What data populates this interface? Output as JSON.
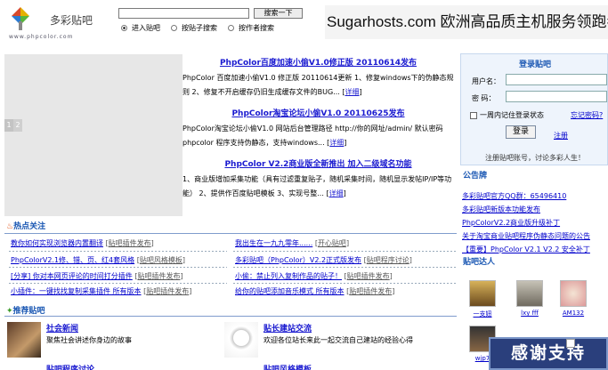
{
  "logo": {
    "name": "多彩贴吧",
    "url": "www.phpcolor.com"
  },
  "search": {
    "button": "搜索一下",
    "radios": [
      "进入贴吧",
      "按贴子搜索",
      "按作者搜索"
    ],
    "selected": 0
  },
  "banner": {
    "text": "Sugarhosts.com 欧洲高品质主机服务领跑者"
  },
  "slider": {
    "prev": "1",
    "next": "2"
  },
  "news": [
    {
      "title": "PhpColor百度加速小偷V1.0修正版 20110614发布",
      "desc": "PhpColor 百度加速小偷V1.0 修正版 20110614更新 1、修复windows下的伪静态规则 2、修复不开启缓存仍旧生成缓存文件的BUG...",
      "more": "详细"
    },
    {
      "title": "PhpColor淘宝论坛小偷V1.0 20110625发布",
      "desc": "PhpColor淘宝论坛小偷V1.0 网站后台管理路径 http://你的网址/admin/ 默认密码 phpcolor 程序支持伪静态，支持windows...",
      "more": "详细"
    },
    {
      "title": "PhpColor V2.2商业版全新推出 加入二级域名功能",
      "desc": "1、商业版增加采集功能（具有过滤重复贴子，随机采集时间，随机显示发帖IP/IP等功能） 2、提供作百度贴吧模板 3、实现号整...",
      "more": "详细"
    }
  ],
  "login": {
    "title": "登录贴吧",
    "user_label": "用户名：",
    "pass_label": "密  码：",
    "remember": "一周内记住登录状态",
    "forgot": "忘记密码?",
    "login_btn": "登录",
    "register": "注册",
    "hint": "注册贴吧账号，讨论多彩人生！"
  },
  "notice": {
    "title": "公告牌",
    "items": [
      "多彩贴吧官方QQ群：65496410",
      "多彩贴吧新版本功能发布",
      "PhpColorV2.2商业版升级补丁",
      "关于淘宝商业贴吧程序伪静态问题的公告",
      "【重要】PhpColor V2.1 V2.2 安全补丁"
    ]
  },
  "users": {
    "title": "贴吧达人",
    "items": [
      "一支妞",
      "lxy fff",
      "AM132",
      "wjp7"
    ]
  },
  "hot": {
    "title": "热点关注",
    "items": [
      {
        "title": "教你如何实现浏览器内置翻译",
        "tag": "贴吧插件发布"
      },
      {
        "title": "我出生在一九九零年......",
        "tag": "开心贴吧"
      },
      {
        "title": "PhpColorV2.1修、错、页、红4套风格",
        "tag": "贴吧风格模板"
      },
      {
        "title": "多彩贴吧（PhpColor）V2.2正式版发布",
        "tag": "贴吧程序讨论"
      },
      {
        "title": "[分享] 你对本网页评论的时间打分插件",
        "tag": "贴吧插件发布"
      },
      {
        "title": "小偷：禁止列入复制作品的贴子！",
        "tag": "贴吧插件发布"
      },
      {
        "title": "小插件：一键找找复制采集插件 所有版本",
        "tag": "贴吧插件发布"
      },
      {
        "title": "给你的贴吧添加音乐模式 所有版本",
        "tag": "贴吧插件发布"
      }
    ]
  },
  "recommend": {
    "title": "推荐贴吧",
    "items": [
      {
        "title": "社会新闻",
        "desc": "聚焦社会讲述你身边的故事"
      },
      {
        "title": "贴长建站交流",
        "desc": "欢迎各位站长来此一起交流自己建站的经验心得"
      },
      {
        "title": "贴吧程序讨论",
        "desc": ""
      },
      {
        "title": "贴吧风格模板",
        "desc": ""
      }
    ]
  },
  "float": {
    "thanks": "感谢支持"
  }
}
